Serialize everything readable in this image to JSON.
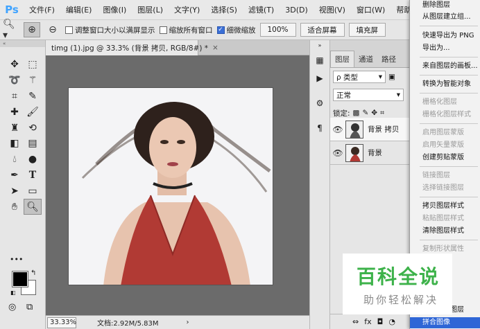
{
  "menubar": {
    "logo": "Ps",
    "items": [
      "文件(F)",
      "编辑(E)",
      "图像(I)",
      "图层(L)",
      "文字(Y)",
      "选择(S)",
      "滤镜(T)",
      "3D(D)",
      "视图(V)",
      "窗口(W)",
      "帮助(H)"
    ]
  },
  "options": {
    "resize_windows": "调整窗口大小以满屏显示",
    "zoom_all": "缩放所有窗口",
    "scrubby_zoom": "细微缩放",
    "zoom_100": "100%",
    "fit_screen": "适合屏幕",
    "fill_screen": "填充屏"
  },
  "document": {
    "tab_title": "timg (1).jpg @ 33.3% (背景 拷贝, RGB/8#) *",
    "close_symbol": "×",
    "zoom": "33.33%",
    "doc_info": "文档:2.92M/5.83M",
    "arrow": "›"
  },
  "layers_panel": {
    "tabs": [
      "图层",
      "通道",
      "路径"
    ],
    "kind_filter": "ρ 类型",
    "blend_mode": "正常",
    "lock_label": "锁定:",
    "layers": [
      {
        "name": "背景 拷贝",
        "visible": true
      },
      {
        "name": "背景",
        "visible": true
      }
    ],
    "footer": [
      "⇔",
      "fx",
      "◘",
      "◔"
    ]
  },
  "context_menu": {
    "items": [
      {
        "label": "删除图层",
        "enabled": true
      },
      {
        "label": "从图层建立组...",
        "enabled": true
      },
      {
        "label": "快速导出为 PNG",
        "enabled": true
      },
      {
        "label": "导出为...",
        "enabled": true
      },
      {
        "label": "来自图层的画板...",
        "enabled": true
      },
      {
        "label": "转换为智能对象",
        "enabled": true
      },
      {
        "label": "栅格化图层",
        "enabled": false
      },
      {
        "label": "栅格化图层样式",
        "enabled": false
      },
      {
        "label": "启用图层蒙版",
        "enabled": false
      },
      {
        "label": "启用矢量蒙版",
        "enabled": false
      },
      {
        "label": "创建剪贴蒙版",
        "enabled": true
      },
      {
        "label": "链接图层",
        "enabled": false
      },
      {
        "label": "选择链接图层",
        "enabled": false
      },
      {
        "label": "拷贝图层样式",
        "enabled": true
      },
      {
        "label": "粘贴图层样式",
        "enabled": false
      },
      {
        "label": "清除图层样式",
        "enabled": true
      },
      {
        "label": "复制形状属性",
        "enabled": false
      },
      {
        "label": "合并可见图层",
        "enabled": true
      },
      {
        "label": "拼合图像",
        "enabled": true,
        "highlighted": true
      }
    ]
  },
  "watermark": {
    "title": "百科全说",
    "subtitle": "助你轻松解决"
  },
  "colors": {
    "accent": "#2f66d6",
    "ps_blue": "#3fa3ff",
    "watermark_green": "#3db24a",
    "dress_red": "#b13a34"
  }
}
